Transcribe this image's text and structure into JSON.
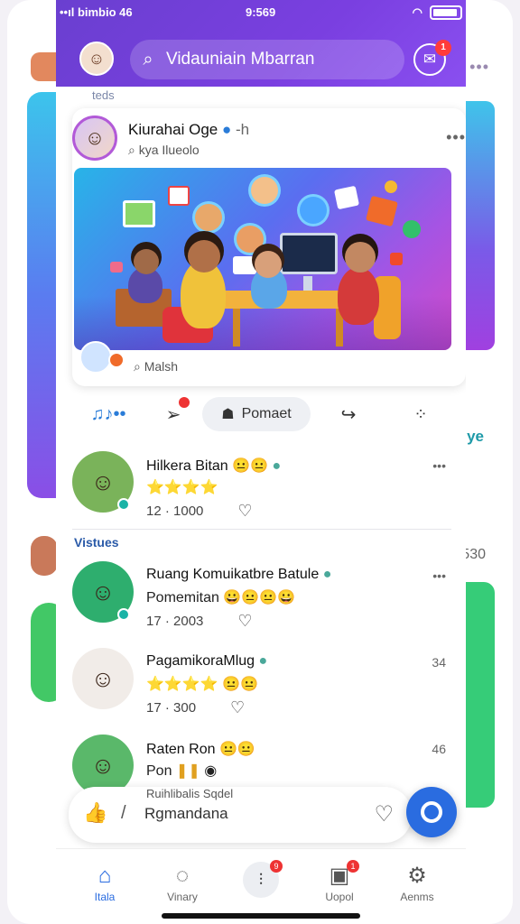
{
  "status_bar": {
    "left": "••ıl bimbio 46",
    "time": "9:569"
  },
  "search": {
    "placeholder": "Vidauniain Mbarran"
  },
  "notifications": {
    "badge": "1"
  },
  "feed_label": "teds",
  "post": {
    "author": "Kiurahai Oge",
    "author_suffix": "-h",
    "subtitle": "kya Ilueolo",
    "image_caption": "Malsh",
    "actions": {
      "pill_label": "Pomaet"
    }
  },
  "comments": [
    {
      "name": "Hilkera Bitan",
      "line2": "⭐⭐⭐⭐",
      "meta": "12 · 1000",
      "right": "•••"
    },
    {
      "name": "Ruang Komuikatbre Batule",
      "line2": "Pomemitan 😀😐😐😀",
      "meta": "17 · 2003",
      "right": "•••"
    },
    {
      "name": "PagamikoraMlug",
      "line2": "⭐⭐⭐⭐ 😐😐",
      "meta": "17 · 300",
      "right": "34"
    },
    {
      "name": "Raten Ron",
      "line2": "Pon",
      "meta": "",
      "right": "46"
    }
  ],
  "section_label": "Vistues",
  "composer": {
    "top_text": "Ruihlibalis Sqdel",
    "placeholder": "Rgmandana"
  },
  "bottom_nav": [
    {
      "label": "Itala",
      "icon": "home-icon"
    },
    {
      "label": "Vinary",
      "icon": "chat-icon"
    },
    {
      "label": "",
      "icon": "grid-icon",
      "badge": "9"
    },
    {
      "label": "Uopol",
      "icon": "media-icon",
      "badge": "1"
    },
    {
      "label": "Aenms",
      "icon": "gear-icon"
    }
  ],
  "background": {
    "right_text": "ye",
    "right_number": "530"
  },
  "colors": {
    "header": "#7a3fe0",
    "accent": "#2a6ce0",
    "badge": "#ff3b3b"
  }
}
